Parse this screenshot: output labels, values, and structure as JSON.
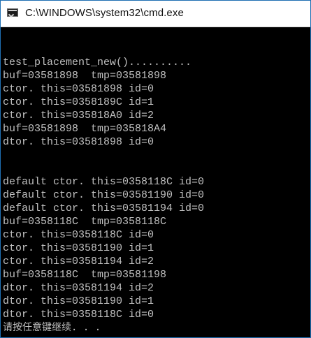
{
  "window": {
    "title": "C:\\WINDOWS\\system32\\cmd.exe",
    "icon": "cmd-icon"
  },
  "colors": {
    "background": "#000000",
    "text": "#c0c0c0",
    "titlebar": "#ffffff",
    "border": "#1f6fb2"
  },
  "console": {
    "lines": [
      "",
      "test_placement_new()..........",
      "buf=03581898  tmp=03581898",
      "ctor. this=03581898 id=0",
      "ctor. this=0358189C id=1",
      "ctor. this=035818A0 id=2",
      "buf=03581898  tmp=035818A4",
      "dtor. this=03581898 id=0",
      "",
      "",
      "default ctor. this=0358118C id=0",
      "default ctor. this=03581190 id=0",
      "default ctor. this=03581194 id=0",
      "buf=0358118C  tmp=0358118C",
      "ctor. this=0358118C id=0",
      "ctor. this=03581190 id=1",
      "ctor. this=03581194 id=2",
      "buf=0358118C  tmp=03581198",
      "dtor. this=03581194 id=2",
      "dtor. this=03581190 id=1",
      "dtor. this=0358118C id=0",
      "请按任意键继续. . ."
    ]
  }
}
